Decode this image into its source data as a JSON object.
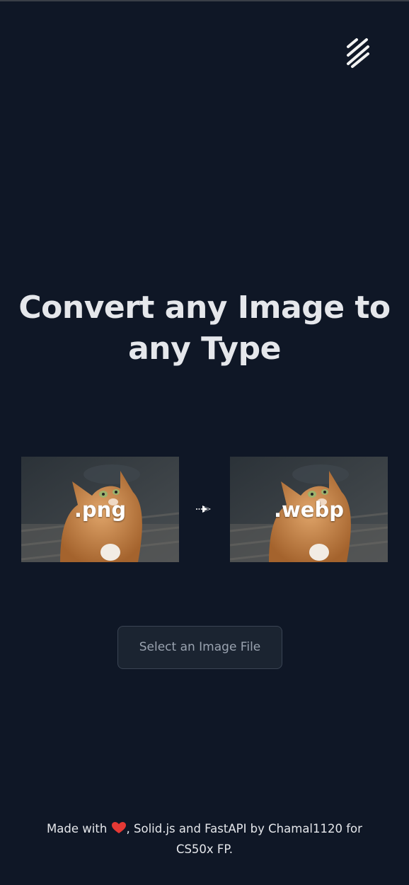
{
  "header": {
    "menu_icon": "menu-slashes-icon"
  },
  "hero": {
    "title": "Convert any Image to any Type"
  },
  "preview": {
    "source_ext": ".png",
    "target_ext": ".webp",
    "arrow_icon": "arrow-right-icon"
  },
  "upload": {
    "button_label": "Select an Image File"
  },
  "footer": {
    "text_before": "Made with ",
    "heart_icon": "heart-icon",
    "text_after": ", Solid.js and FastAPI by Chamal1120 for CS50x FP."
  },
  "colors": {
    "background": "#0f1726",
    "text": "#e5e7eb",
    "button_bg": "#1b2431",
    "button_border": "#3a4453",
    "button_text": "#9aa3b0",
    "heart": "#e53935"
  }
}
